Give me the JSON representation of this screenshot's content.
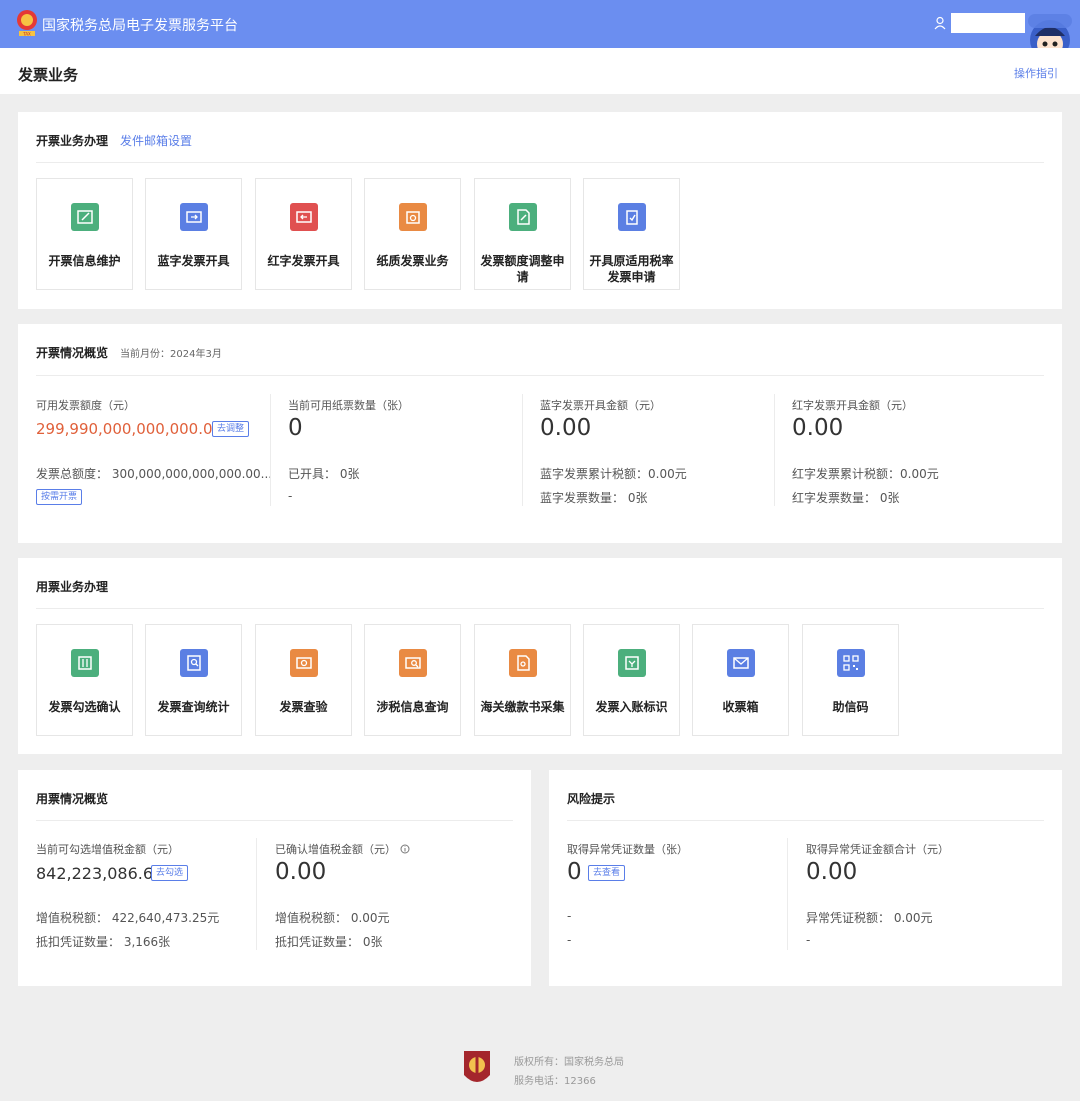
{
  "header": {
    "app_title": "国家税务总局电子发票服务平台",
    "logo_caption": "TAX"
  },
  "page": {
    "title": "发票业务",
    "guide_link": "操作指引"
  },
  "issue_business": {
    "title": "开票业务办理",
    "email_link": "发件邮箱设置",
    "tiles": [
      {
        "label": "开票信息维护",
        "icon": "edit-invoice-icon",
        "color": "#4caf7d"
      },
      {
        "label": "蓝字发票开具",
        "icon": "blue-invoice-icon",
        "color": "#5b7fe3"
      },
      {
        "label": "红字发票开具",
        "icon": "red-invoice-icon",
        "color": "#e05050"
      },
      {
        "label": "纸质发票业务",
        "icon": "paper-invoice-icon",
        "color": "#e98a43"
      },
      {
        "label": "发票额度调整申请",
        "icon": "quota-adjust-icon",
        "color": "#4caf7d"
      },
      {
        "label": "开具原适用税率发票申请",
        "icon": "tax-rate-apply-icon",
        "color": "#5b7fe3"
      }
    ]
  },
  "issue_overview": {
    "title": "开票情况概览",
    "current_month": "当前月份：2024年3月",
    "quota": {
      "label": "可用发票额度（元）",
      "value": "299,990,000,000,000.00",
      "adjust_tag": "去调整",
      "total_line": "发票总额度：  300,000,000,000,000.00...",
      "on_demand_tag": "按需开票"
    },
    "paper": {
      "label": "当前可用纸票数量（张）",
      "value": "0",
      "issued_line": "已开具：  0张",
      "dash": "-"
    },
    "blue": {
      "label": "蓝字发票开具金额（元）",
      "value": "0.00",
      "tax_line": "蓝字发票累计税额：0.00元",
      "count_line": "蓝字发票数量：  0张"
    },
    "red": {
      "label": "红字发票开具金额（元）",
      "value": "0.00",
      "tax_line": "红字发票累计税额：0.00元",
      "count_line": "红字发票数量：  0张"
    }
  },
  "use_business": {
    "title": "用票业务办理",
    "tiles": [
      {
        "label": "发票勾选确认",
        "icon": "invoice-select-icon",
        "color": "#4caf7d"
      },
      {
        "label": "发票查询统计",
        "icon": "invoice-query-icon",
        "color": "#5b7fe3"
      },
      {
        "label": "发票查验",
        "icon": "invoice-verify-icon",
        "color": "#e98a43"
      },
      {
        "label": "涉税信息查询",
        "icon": "tax-info-query-icon",
        "color": "#e98a43"
      },
      {
        "label": "海关缴款书采集",
        "icon": "customs-collect-icon",
        "color": "#e98a43"
      },
      {
        "label": "发票入账标识",
        "icon": "invoice-ledger-icon",
        "color": "#4caf7d"
      },
      {
        "label": "收票箱",
        "icon": "mailbox-icon",
        "color": "#5b7fe3"
      },
      {
        "label": "助信码",
        "icon": "qr-code-icon",
        "color": "#5b7fe3"
      }
    ]
  },
  "use_overview": {
    "title": "用票情况概览",
    "selectable": {
      "label": "当前可勾选增值税金额（元）",
      "value": "842,223,086.60",
      "tag": "去勾选",
      "tax_line": "增值税税额：  422,640,473.25元",
      "count_line": "抵扣凭证数量：  3,166张"
    },
    "confirmed": {
      "label": "已确认增值税金额（元）",
      "value": "0.00",
      "tax_line": "增值税税额：  0.00元",
      "count_line": "抵扣凭证数量：  0张"
    }
  },
  "risk": {
    "title": "风险提示",
    "abnormal_count": {
      "label": "取得异常凭证数量（张）",
      "value": "0",
      "tag": "去查看",
      "line1": "-",
      "line2": "-"
    },
    "abnormal_amount": {
      "label": "取得异常凭证金额合计（元）",
      "value": "0.00",
      "line1": "异常凭证税额：  0.00元",
      "line2": "-"
    }
  },
  "footer": {
    "copyright": "版权所有：国家税务总局",
    "phone": "服务电话：12366"
  }
}
